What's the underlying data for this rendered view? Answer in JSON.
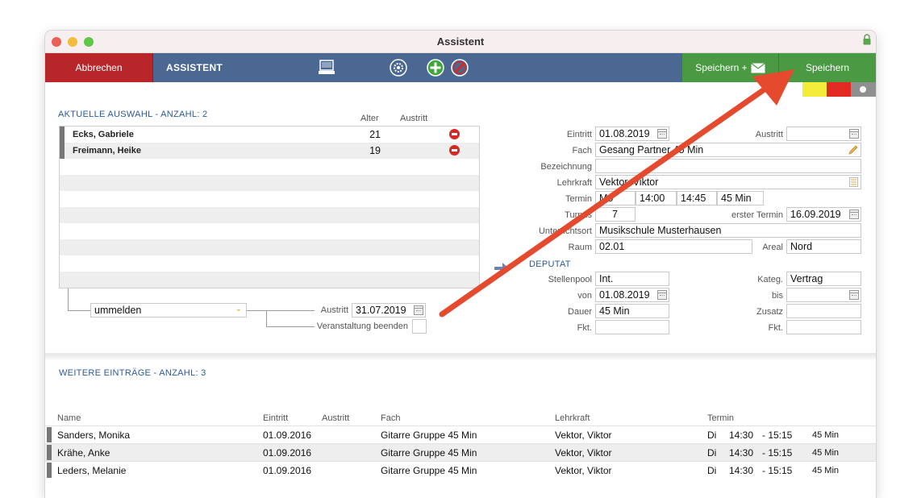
{
  "window": {
    "title": "Assistent"
  },
  "toolbar": {
    "cancel_label": "Abbrechen",
    "assistant_label": "ASSISTENT",
    "save_mail_label": "Speichern +",
    "save_label": "Speichern",
    "icons": [
      "printer-icon",
      "settings-icon",
      "add-icon",
      "delete-icon",
      "mail-icon"
    ]
  },
  "colors": {
    "cancel": "#b8262a",
    "save": "#4a9a43",
    "toolbar": "#4a6891",
    "accent_text": "#2a5a9c",
    "annotation_arrow": "#e54a2e"
  },
  "selection": {
    "title": "AKTUELLE AUSWAHL - ANZAHL: 2",
    "col_age": "Alter",
    "col_exit": "Austritt",
    "rows": [
      {
        "name": "Ecks, Gabriele",
        "age": "21"
      },
      {
        "name": "Freimann, Heike",
        "age": "19"
      }
    ],
    "action_value": "ummelden",
    "exit_label": "Austritt",
    "exit_value": "31.07.2019",
    "end_event_label": "Veranstaltung beenden"
  },
  "form": {
    "eintritt_label": "Eintritt",
    "eintritt_value": "01.08.2019",
    "austritt_label": "Austritt",
    "austritt_value": "",
    "fach_label": "Fach",
    "fach_value": "Gesang Partner 45 Min",
    "bezeichnung_label": "Bezeichnung",
    "bezeichnung_value": "",
    "lehrkraft_label": "Lehrkraft",
    "lehrkraft_value": "Vektor, Viktor",
    "termin_label": "Termin",
    "termin_day": "Mo",
    "termin_start": "14:00",
    "termin_end": "14:45",
    "termin_duration": "45 Min",
    "turnus_label": "Turnus",
    "turnus_value": "7",
    "erster_termin_label": "erster Termin",
    "erster_termin_value": "16.09.2019",
    "ort_label": "Unterrichtsort",
    "ort_value": "Musikschule Musterhausen",
    "raum_label": "Raum",
    "raum_value": "02.01",
    "areal_label": "Areal",
    "areal_value": "Nord",
    "deputat_title": "DEPUTAT",
    "stellenpool_label": "Stellenpool",
    "stellenpool_value": "Int.",
    "kateg_label": "Kateg.",
    "kateg_value": "Vertrag",
    "von_label": "von",
    "von_value": "01.08.2019",
    "bis_label": "bis",
    "bis_value": "",
    "dauer_label": "Dauer",
    "dauer_value": "45 Min",
    "zusatz_label": "Zusatz",
    "zusatz_value": "",
    "fkt_label": "Fkt.",
    "fkt_value": "",
    "fkt2_label": "Fkt.",
    "fkt2_value": ""
  },
  "more": {
    "title": "WEITERE EINTRÄGE - ANZAHL: 3",
    "headers": {
      "name": "Name",
      "eintritt": "Eintritt",
      "austritt": "Austritt",
      "fach": "Fach",
      "lehrkraft": "Lehrkraft",
      "termin": "Termin"
    },
    "rows": [
      {
        "name": "Sanders, Monika",
        "eintritt": "01.09.2016",
        "austritt": "",
        "fach": "Gitarre Gruppe 45 Min",
        "lehrkraft": "Vektor, Viktor",
        "day": "Di",
        "start": "14:30",
        "end": "- 15:15",
        "dur": "45 Min"
      },
      {
        "name": "Krähe, Anke",
        "eintritt": "01.09.2016",
        "austritt": "",
        "fach": "Gitarre Gruppe 45 Min",
        "lehrkraft": "Vektor, Viktor",
        "day": "Di",
        "start": "14:30",
        "end": "- 15:15",
        "dur": "45 Min"
      },
      {
        "name": "Leders, Melanie",
        "eintritt": "01.09.2016",
        "austritt": "",
        "fach": "Gitarre Gruppe 45 Min",
        "lehrkraft": "Vektor, Viktor",
        "day": "Di",
        "start": "14:30",
        "end": "- 15:15",
        "dur": "45 Min"
      }
    ]
  }
}
